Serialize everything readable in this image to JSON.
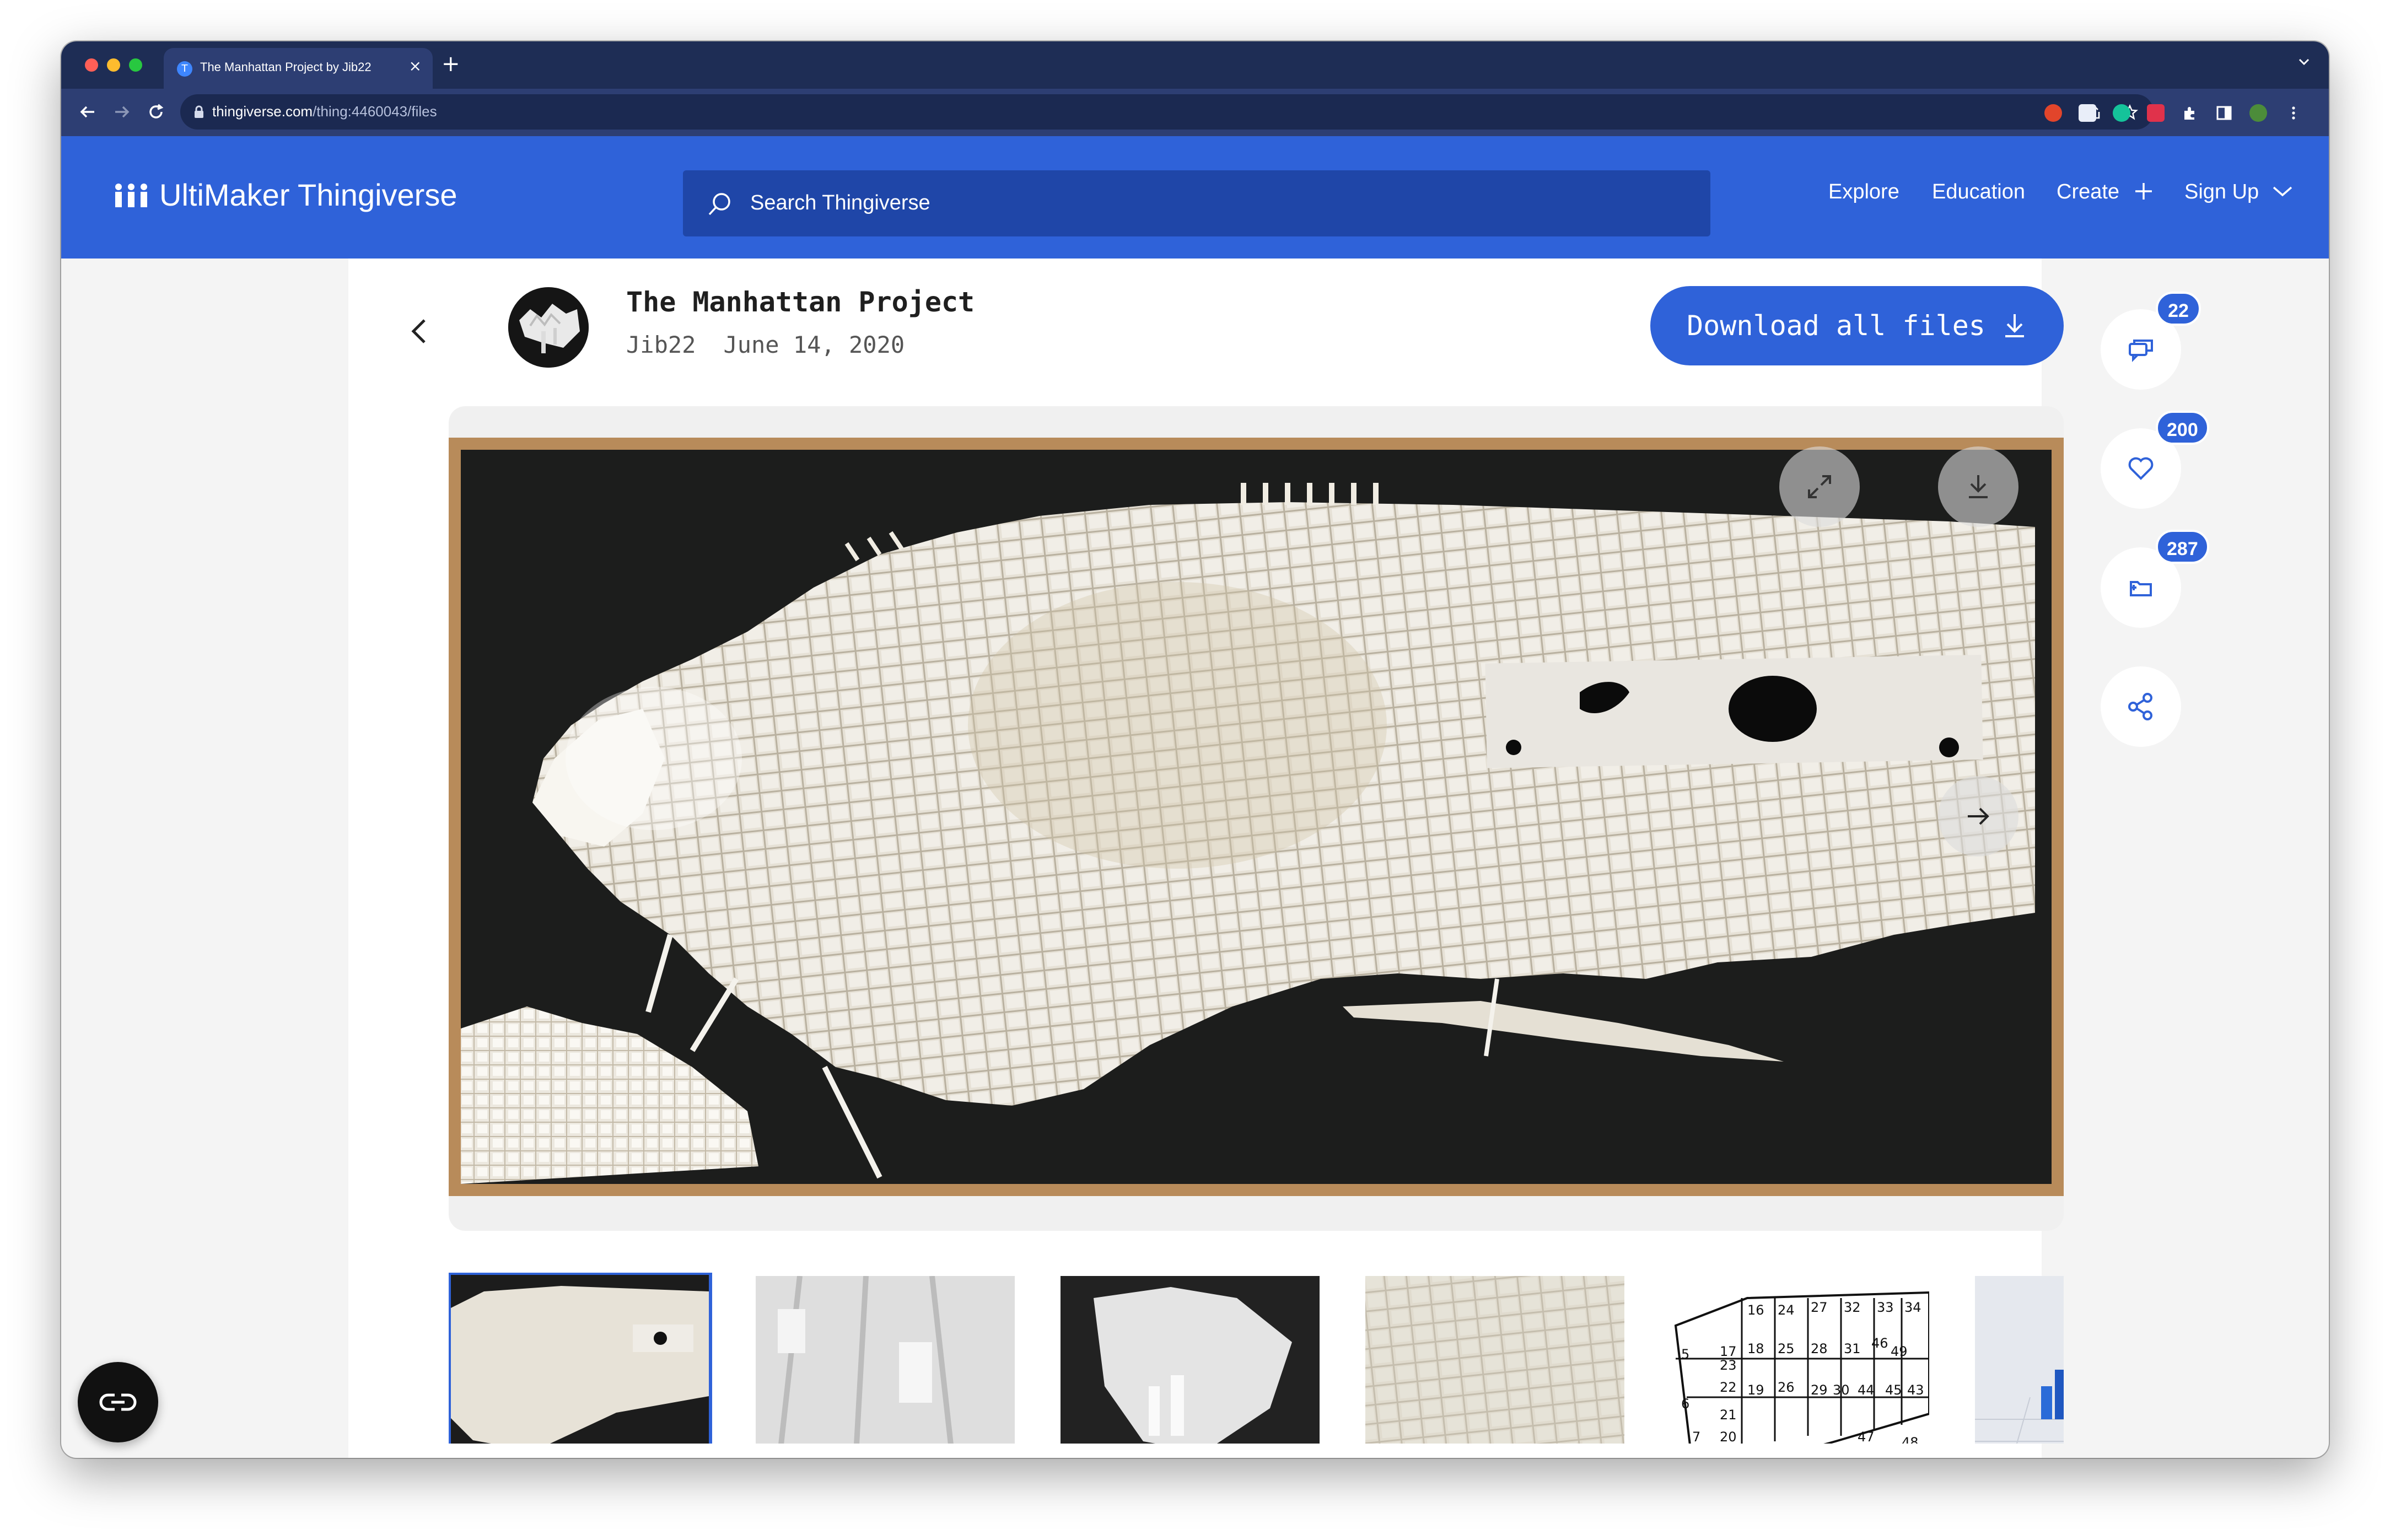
{
  "browser": {
    "tab_title": "The Manhattan Project by Jib22",
    "tab_favicon": "T",
    "url_host": "thingiverse.com",
    "url_path": "/thing:4460043/files"
  },
  "site": {
    "logo_text": "UltiMaker Thingiverse",
    "search_placeholder": "Search Thingiverse",
    "nav": {
      "explore": "Explore",
      "education": "Education",
      "create": "Create",
      "signup": "Sign Up"
    }
  },
  "thing": {
    "title": "The Manhattan Project",
    "author": "Jib22",
    "date": "June 14, 2020",
    "download_all_label": "Download all files"
  },
  "actions": {
    "comments_count": "22",
    "likes_count": "200",
    "collections_count": "287"
  },
  "thumbnails": [
    {
      "name": "thumb-1",
      "selected": true
    },
    {
      "name": "thumb-2",
      "selected": false
    },
    {
      "name": "thumb-3",
      "selected": false
    },
    {
      "name": "thumb-4",
      "selected": false
    },
    {
      "name": "thumb-5-map",
      "selected": false
    },
    {
      "name": "thumb-6",
      "selected": false
    }
  ],
  "map_thumb_numbers": [
    "16",
    "24",
    "27",
    "32",
    "33",
    "34",
    "5",
    "17",
    "18",
    "25",
    "28",
    "31",
    "46",
    "49",
    "23",
    "22",
    "19",
    "26",
    "29",
    "30",
    "44",
    "45",
    "43",
    "6",
    "21",
    "7",
    "20",
    "47",
    "48"
  ],
  "colors": {
    "brand_blue": "#2f62d9",
    "browser_dark": "#1e2d55",
    "frame_wood": "#b88b5a"
  }
}
